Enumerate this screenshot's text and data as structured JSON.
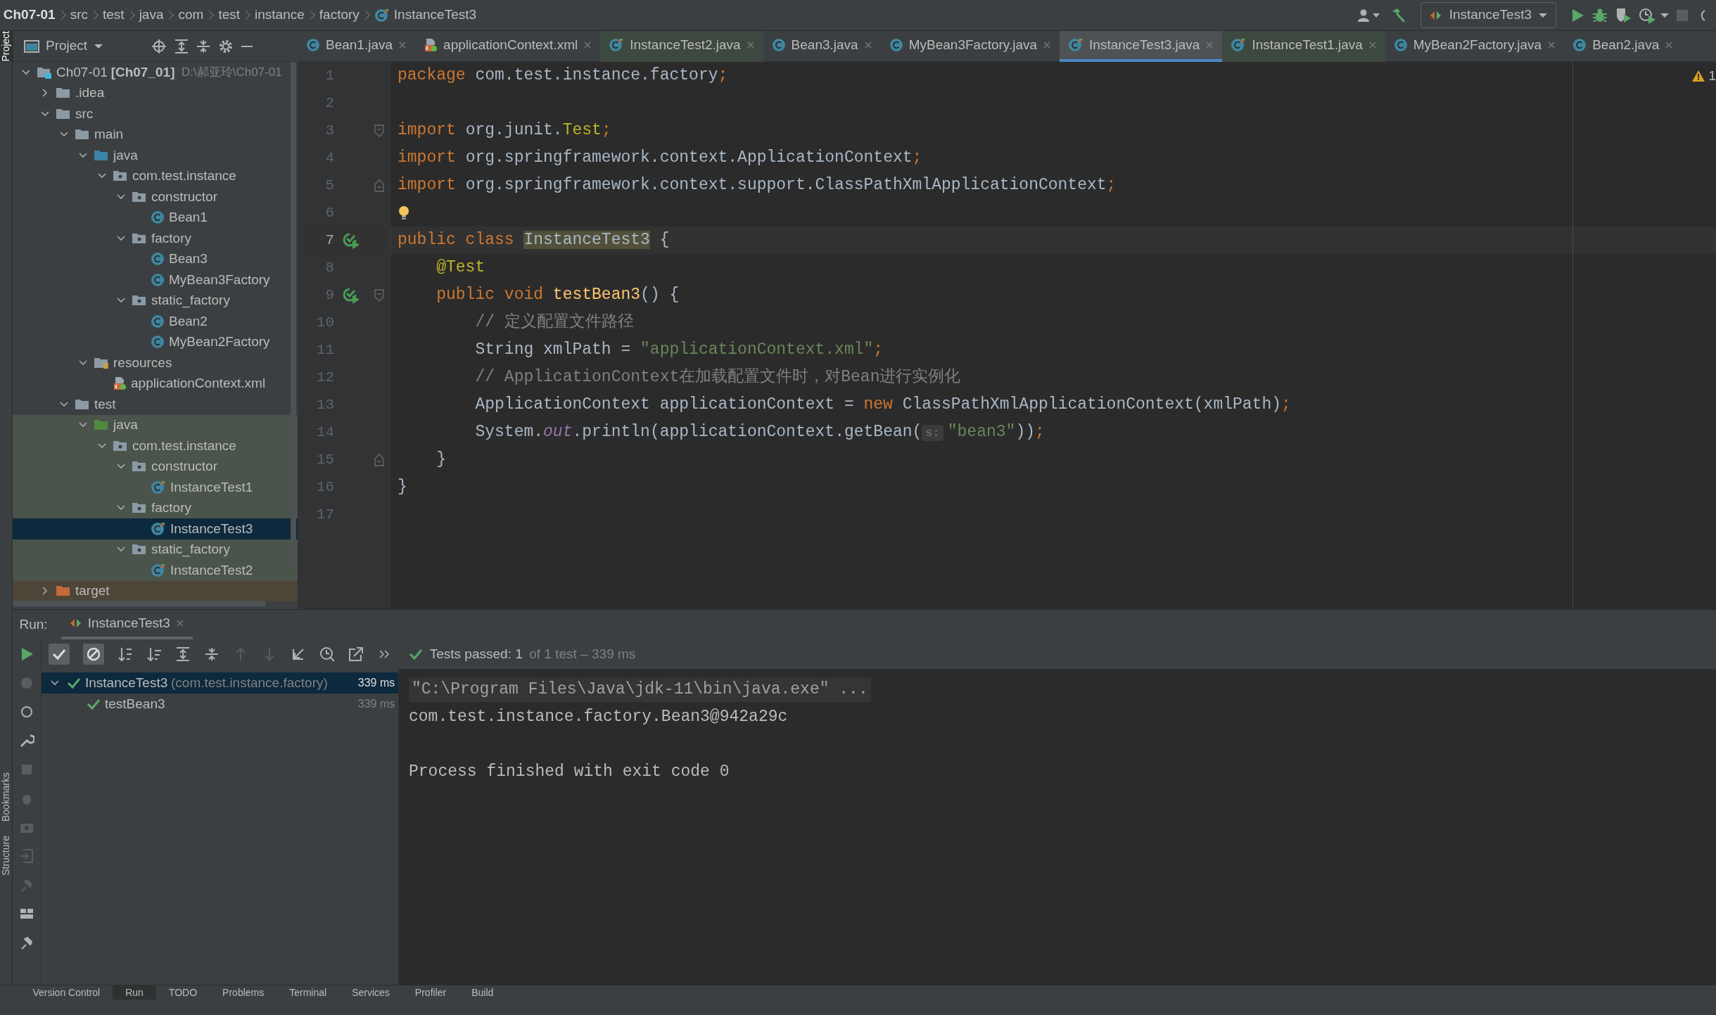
{
  "breadcrumbs": [
    {
      "label": "Ch07-01",
      "kind": "project"
    },
    {
      "label": "src",
      "kind": "folder"
    },
    {
      "label": "test",
      "kind": "folder"
    },
    {
      "label": "java",
      "kind": "folder"
    },
    {
      "label": "com",
      "kind": "folder"
    },
    {
      "label": "test",
      "kind": "folder"
    },
    {
      "label": "instance",
      "kind": "folder"
    },
    {
      "label": "factory",
      "kind": "folder"
    },
    {
      "label": "InstanceTest3",
      "kind": "test_class"
    }
  ],
  "run_config": "InstanceTest3",
  "side_labels": [
    {
      "label": "Project",
      "selected": true
    },
    {
      "label": "Bookmarks",
      "selected": false
    },
    {
      "label": "Structure",
      "selected": false
    }
  ],
  "project_panel": {
    "title": "Project",
    "tree": [
      {
        "kind": "module",
        "label": "Ch07-01",
        "module": "[Ch07_01]",
        "path": "D:\\郝亚玲\\Ch07-01",
        "expanded": true,
        "selected": false,
        "children": [
          {
            "kind": "folder",
            "label": ".idea",
            "expanded": false,
            "selected": false
          },
          {
            "kind": "folder",
            "label": "src",
            "expanded": true,
            "selected": false,
            "children": [
              {
                "kind": "folder",
                "label": "main",
                "expanded": true,
                "selected": false,
                "children": [
                  {
                    "kind": "source_root",
                    "label": "java",
                    "expanded": true,
                    "selected": false,
                    "children": [
                      {
                        "kind": "package",
                        "label": "com.test.instance",
                        "expanded": true,
                        "selected": false,
                        "children": [
                          {
                            "kind": "package",
                            "label": "constructor",
                            "expanded": true,
                            "selected": false,
                            "children": [
                              {
                                "kind": "class",
                                "label": "Bean1",
                                "selected": false
                              }
                            ]
                          },
                          {
                            "kind": "package",
                            "label": "factory",
                            "expanded": true,
                            "selected": false,
                            "children": [
                              {
                                "kind": "class",
                                "label": "Bean3",
                                "selected": false
                              },
                              {
                                "kind": "class",
                                "label": "MyBean3Factory",
                                "selected": false
                              }
                            ]
                          },
                          {
                            "kind": "package",
                            "label": "static_factory",
                            "expanded": true,
                            "selected": false,
                            "children": [
                              {
                                "kind": "class",
                                "label": "Bean2",
                                "selected": false
                              },
                              {
                                "kind": "class",
                                "label": "MyBean2Factory",
                                "selected": false
                              }
                            ]
                          }
                        ]
                      }
                    ]
                  },
                  {
                    "kind": "resources_root",
                    "label": "resources",
                    "expanded": true,
                    "selected": false,
                    "children": [
                      {
                        "kind": "xml",
                        "label": "applicationContext.xml",
                        "selected": false
                      }
                    ]
                  }
                ]
              },
              {
                "kind": "folder",
                "label": "test",
                "expanded": true,
                "selected": false,
                "children": [
                  {
                    "kind": "test_root",
                    "label": "java",
                    "expanded": true,
                    "selected": false,
                    "children": [
                      {
                        "kind": "package",
                        "label": "com.test.instance",
                        "expanded": true,
                        "selected": false,
                        "children": [
                          {
                            "kind": "package",
                            "label": "constructor",
                            "expanded": true,
                            "selected": false,
                            "children": [
                              {
                                "kind": "test_class",
                                "label": "InstanceTest1",
                                "selected": false
                              }
                            ]
                          },
                          {
                            "kind": "package",
                            "label": "factory",
                            "expanded": true,
                            "selected": false,
                            "children": [
                              {
                                "kind": "test_class",
                                "label": "InstanceTest3",
                                "selected": true
                              }
                            ]
                          },
                          {
                            "kind": "package",
                            "label": "static_factory",
                            "expanded": true,
                            "selected": false,
                            "children": [
                              {
                                "kind": "test_class",
                                "label": "InstanceTest2",
                                "selected": false
                              }
                            ]
                          }
                        ]
                      }
                    ]
                  }
                ]
              }
            ]
          },
          {
            "kind": "excluded",
            "label": "target",
            "expanded": false,
            "selected": false
          }
        ]
      }
    ]
  },
  "editor_tabs": [
    {
      "label": "Bean1.java",
      "kind": "class",
      "selected": false
    },
    {
      "label": "applicationContext.xml",
      "kind": "xml",
      "selected": false
    },
    {
      "label": "InstanceTest2.java",
      "kind": "test_class",
      "selected": false
    },
    {
      "label": "Bean3.java",
      "kind": "class",
      "selected": false
    },
    {
      "label": "MyBean3Factory.java",
      "kind": "class",
      "selected": false
    },
    {
      "label": "InstanceTest3.java",
      "kind": "test_class",
      "selected": true
    },
    {
      "label": "InstanceTest1.java",
      "kind": "test_class",
      "selected": false
    },
    {
      "label": "MyBean2Factory.java",
      "kind": "class",
      "selected": false
    },
    {
      "label": "Bean2.java",
      "kind": "class",
      "selected": false
    }
  ],
  "editor": {
    "warning_count": "1",
    "lines": [
      {
        "number": "1",
        "current": false,
        "tokens": [
          {
            "kind": "kw",
            "text": "package"
          },
          {
            "kind": "plain",
            "text": " com.test.instance.factory"
          },
          {
            "kind": "kw",
            "text": ";"
          }
        ]
      },
      {
        "number": "2",
        "current": false
      },
      {
        "number": "3",
        "current": false,
        "fold_start": true,
        "tokens": [
          {
            "kind": "kw",
            "text": "import"
          },
          {
            "kind": "plain",
            "text": " org.junit."
          },
          {
            "kind": "ann",
            "text": "Test"
          },
          {
            "kind": "kw",
            "text": ";"
          }
        ]
      },
      {
        "number": "4",
        "current": false,
        "tokens": [
          {
            "kind": "kw",
            "text": "import"
          },
          {
            "kind": "plain",
            "text": " org.springframework.context.ApplicationContext"
          },
          {
            "kind": "kw",
            "text": ";"
          }
        ]
      },
      {
        "number": "5",
        "current": false,
        "fold_end": true,
        "tokens": [
          {
            "kind": "kw",
            "text": "import"
          },
          {
            "kind": "plain",
            "text": " org.springframework.context.support.ClassPathXmlApplicationContext"
          },
          {
            "kind": "kw",
            "text": ";"
          }
        ]
      },
      {
        "number": "6",
        "current": false,
        "bulb": true
      },
      {
        "number": "7",
        "current": true,
        "run": true,
        "tokens": [
          {
            "kind": "kw",
            "text": "public class "
          },
          {
            "kind": "decl",
            "text": "InstanceTest3"
          },
          {
            "kind": "plain",
            "text": " {"
          }
        ]
      },
      {
        "number": "8",
        "current": false,
        "tokens": [
          {
            "kind": "ann",
            "text": "    @Test"
          }
        ]
      },
      {
        "number": "9",
        "current": false,
        "run": true,
        "fold_start": true,
        "tokens": [
          {
            "kind": "kw",
            "text": "    public void "
          },
          {
            "kind": "method",
            "text": "testBean3"
          },
          {
            "kind": "plain",
            "text": "() {"
          }
        ]
      },
      {
        "number": "10",
        "current": false,
        "tokens": [
          {
            "kind": "cmt",
            "text": "        // 定义配置文件路径"
          }
        ]
      },
      {
        "number": "11",
        "current": false,
        "tokens": [
          {
            "kind": "plain",
            "text": "        String xmlPath = "
          },
          {
            "kind": "str",
            "text": "\"applicationContext.xml\""
          },
          {
            "kind": "kw",
            "text": ";"
          }
        ]
      },
      {
        "number": "12",
        "current": false,
        "tokens": [
          {
            "kind": "cmt",
            "text": "        // ApplicationContext在加载配置文件时，对Bean进行实例化"
          }
        ]
      },
      {
        "number": "13",
        "current": false,
        "tokens": [
          {
            "kind": "plain",
            "text": "        ApplicationContext applicationContext = "
          },
          {
            "kind": "kw",
            "text": "new"
          },
          {
            "kind": "plain",
            "text": " ClassPathXmlApplicationContext(xmlPath)"
          },
          {
            "kind": "kw",
            "text": ";"
          }
        ]
      },
      {
        "number": "14",
        "current": false,
        "tokens": [
          {
            "kind": "plain",
            "text": "        System."
          },
          {
            "kind": "field",
            "text": "out"
          },
          {
            "kind": "plain",
            "text": ".println(applicationContext.getBean("
          },
          {
            "kind": "hint",
            "text": "s:"
          },
          {
            "kind": "str",
            "text": "\"bean3\""
          },
          {
            "kind": "plain",
            "text": "))"
          },
          {
            "kind": "kw",
            "text": ";"
          }
        ]
      },
      {
        "number": "15",
        "current": false,
        "fold_end": true,
        "tokens": [
          {
            "kind": "plain",
            "text": "    }"
          }
        ]
      },
      {
        "number": "16",
        "current": false,
        "tokens": [
          {
            "kind": "plain",
            "text": "}"
          }
        ]
      },
      {
        "number": "17",
        "current": false
      }
    ]
  },
  "run_panel": {
    "title": "Run:",
    "tab": {
      "label": "InstanceTest3",
      "selected": true
    },
    "show_passed": true,
    "show_ignored": true,
    "status": "Tests passed: 1",
    "status_detail": "of 1 test – 339 ms",
    "tests": [
      {
        "label": "InstanceTest3",
        "detail": "(com.test.instance.factory)",
        "time": "339 ms",
        "passed": true,
        "selected": true,
        "expanded": true,
        "children": [
          {
            "label": "testBean3",
            "time": "339 ms",
            "passed": true,
            "selected": false
          }
        ]
      }
    ],
    "console": [
      {
        "kind": "command",
        "text": "\"C:\\Program Files\\Java\\jdk-11\\bin\\java.exe\" ..."
      },
      {
        "kind": "output",
        "text": "com.test.instance.factory.Bean3@942a29c"
      },
      {
        "kind": "blank"
      },
      {
        "kind": "output",
        "text": "Process finished with exit code 0"
      }
    ]
  },
  "bottom_tools": [
    {
      "label": "Version Control",
      "selected": false
    },
    {
      "label": "Run",
      "selected": true
    },
    {
      "label": "TODO",
      "selected": false
    },
    {
      "label": "Problems",
      "selected": false
    },
    {
      "label": "Terminal",
      "selected": false
    },
    {
      "label": "Services",
      "selected": false
    },
    {
      "label": "Profiler",
      "selected": false
    },
    {
      "label": "Build",
      "selected": false
    }
  ]
}
